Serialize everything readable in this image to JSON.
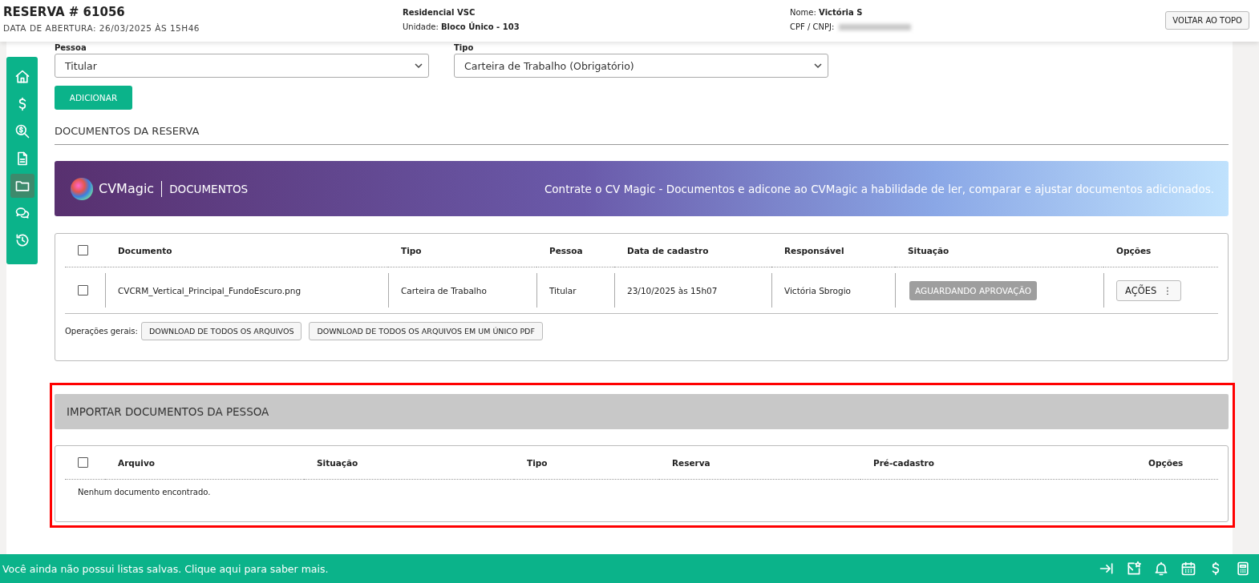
{
  "header": {
    "title": "RESERVA # 61056",
    "subtitle": "DATA DE ABERTURA: 26/03/2025 ÀS 15H46",
    "project": "Residencial VSC",
    "unit_label": "Unidade:",
    "unit_value": "Bloco Único - 103",
    "name_label": "Nome:",
    "name_value": "Victória S",
    "cpf_label": "CPF / CNPJ:",
    "back_button": "VOLTAR AO TOPO"
  },
  "sidebar": {
    "items": [
      {
        "selected": false
      },
      {
        "selected": false
      },
      {
        "selected": false
      },
      {
        "selected": false
      },
      {
        "selected": true
      },
      {
        "selected": false
      },
      {
        "selected": false
      }
    ]
  },
  "form": {
    "fields": [
      {
        "label": "Pessoa",
        "value": "Titular"
      },
      {
        "label": "Tipo",
        "value": "Carteira de Trabalho (Obrigatório)"
      }
    ],
    "add_button": "ADICIONAR"
  },
  "section_title": "DOCUMENTOS DA RESERVA",
  "banner": {
    "brand": "CVMagic",
    "product": "DOCUMENTOS",
    "message": "Contrate o CV Magic - Documentos e adicone ao CVMagic a habilidade de ler, comparar e ajustar documentos adicionados."
  },
  "documents_table": {
    "select_all_checked": false,
    "columns": [
      "Documento",
      "Tipo",
      "Pessoa",
      "Data de cadastro",
      "Responsável",
      "Situação",
      "Opções"
    ],
    "rows": [
      {
        "checked": false,
        "cells": [
          "CVCRM_Vertical_Principal_FundoEscuro.png",
          "Carteira de Trabalho",
          "Titular",
          "23/10/2025 às 15h07",
          "Victória Sbrogio"
        ],
        "status": "AGUARDANDO APROVAÇÃO",
        "action": "AÇÕES",
        "action_icon": "⋮"
      }
    ],
    "operations_label": "Operações gerais:",
    "operations": [
      "DOWNLOAD DE TODOS OS ARQUIVOS",
      "DOWNLOAD DE TODOS OS ARQUIVOS EM UM ÚNICO PDF"
    ]
  },
  "import_section": {
    "title": "IMPORTAR DOCUMENTOS DA PESSOA",
    "select_all_checked": false,
    "columns": [
      "Arquivo",
      "Situação",
      "Tipo",
      "Reserva",
      "Pré-cadastro",
      "Opções"
    ],
    "empty_message": "Nenhum documento encontrado."
  },
  "footer": {
    "message": "Você ainda não possui listas salvas. Clique aqui para saber mais."
  }
}
